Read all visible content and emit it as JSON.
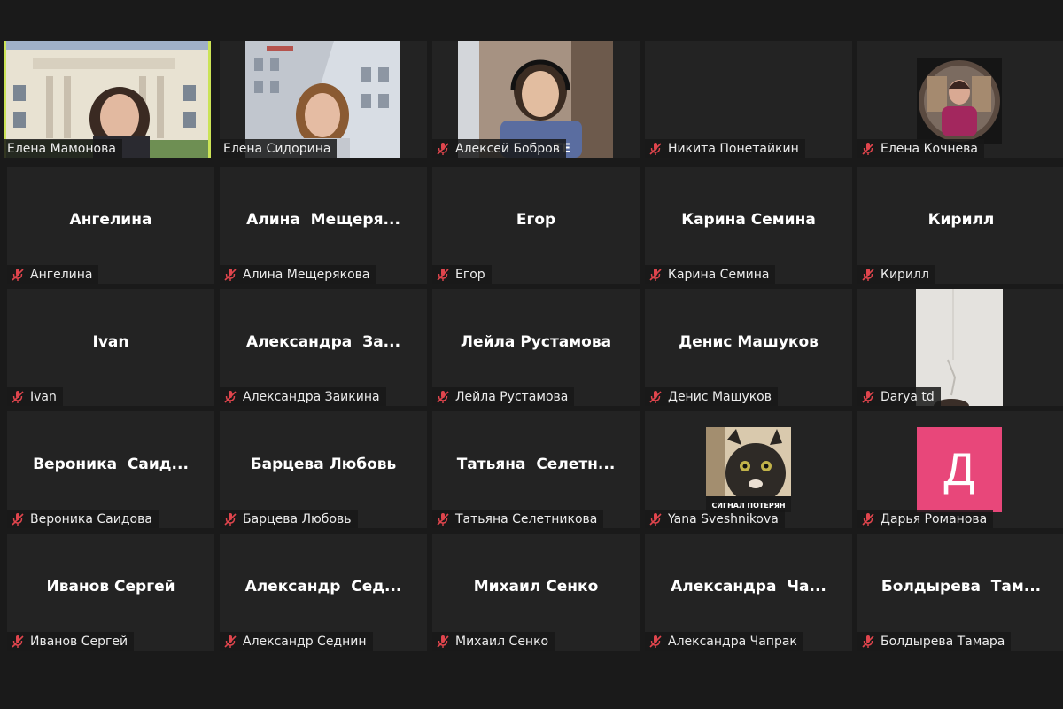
{
  "participants": [
    {
      "label": "Елена Мамонова",
      "muted": false
    },
    {
      "label": "Елена Сидорина",
      "muted": false
    },
    {
      "label": "Алексей Бобров",
      "muted": true
    },
    {
      "label": "Никита Понетайкин",
      "muted": true
    },
    {
      "label": "Елена Кочнева",
      "muted": true
    },
    {
      "display": "Ангелина",
      "label": "Ангелина",
      "muted": true
    },
    {
      "display": "Алина  Мещеря...",
      "label": "Алина Мещерякова",
      "muted": true
    },
    {
      "display": "Егор",
      "label": "Егор",
      "muted": true
    },
    {
      "display": "Карина Семина",
      "label": "Карина Семина",
      "muted": true
    },
    {
      "display": "Кирилл",
      "label": "Кирилл",
      "muted": true
    },
    {
      "display": "Ivan",
      "label": "Ivan",
      "muted": true
    },
    {
      "display": "Александра  За...",
      "label": "Александра Заикина",
      "muted": true
    },
    {
      "display": "Лейла Рустамова",
      "label": "Лейла Рустамова",
      "muted": true
    },
    {
      "display": "Денис Машуков",
      "label": "Денис Машуков",
      "muted": true
    },
    {
      "label": "Darya td",
      "muted": true
    },
    {
      "display": "Вероника  Саид...",
      "label": "Вероника Саидова",
      "muted": true
    },
    {
      "display": "Барцева Любовь",
      "label": "Барцева Любовь",
      "muted": true
    },
    {
      "display": "Татьяна  Селетн...",
      "label": "Татьяна Селетникова",
      "muted": true
    },
    {
      "label": "Yana Sveshnikova",
      "muted": true,
      "image_caption": "СИГНАЛ ПОТЕРЯН"
    },
    {
      "label": "Дарья Романова",
      "muted": true,
      "avatar_letter": "Д"
    },
    {
      "display": "Иванов Сергей",
      "label": "Иванов Сергей",
      "muted": true
    },
    {
      "display": "Александр  Сед...",
      "label": "Александр Седнин",
      "muted": true
    },
    {
      "display": "Михаил Сенко",
      "label": "Михаил Сенко",
      "muted": true
    },
    {
      "display": "Александра  Ча...",
      "label": "Александра Чапрак",
      "muted": true
    },
    {
      "display": "Болдырева  Там...",
      "label": "Болдырева Тамара",
      "muted": true
    }
  ],
  "colors": {
    "active_speaker_border": "#cbe356",
    "muted_icon": "#e0454d",
    "avatar_pink": "#e8477a"
  },
  "icons": {
    "muted": "mic-muted-icon"
  }
}
